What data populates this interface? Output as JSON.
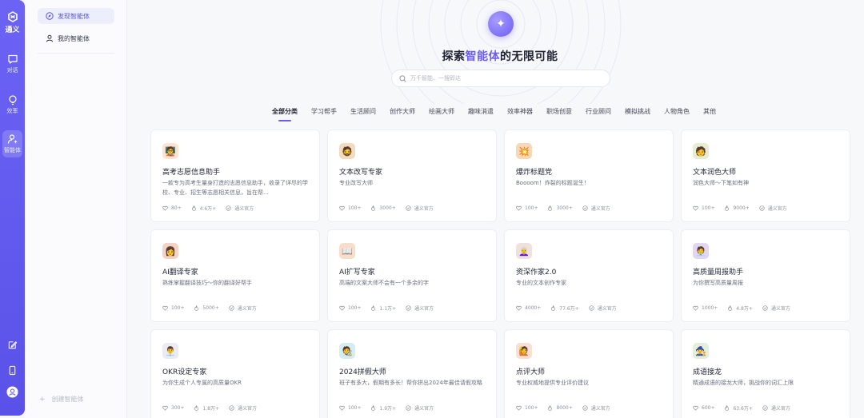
{
  "app": {
    "logo_label": "通义",
    "rail": [
      {
        "label": "对话",
        "icon": "chat-icon"
      },
      {
        "label": "效率",
        "icon": "lightbulb-icon"
      },
      {
        "label": "智能体",
        "icon": "agent-icon"
      }
    ]
  },
  "sidebar": {
    "items": [
      {
        "label": "发现智能体",
        "icon": "compass-icon"
      },
      {
        "label": "我的智能体",
        "icon": "user-icon"
      }
    ],
    "create_label": "创建智能体"
  },
  "hero": {
    "title_prefix": "探索",
    "title_highlight": "智能体",
    "title_suffix": "的无限可能",
    "search_placeholder": "万千智能、一搜即达"
  },
  "tabs": [
    "全部分类",
    "学习帮手",
    "生活顾问",
    "创作大师",
    "绘画大师",
    "趣味消遣",
    "效率神器",
    "职场创意",
    "行业顾问",
    "模拟挑战",
    "人物角色",
    "其他"
  ],
  "cards": [
    {
      "name": "高考志愿信息助手",
      "desc": "一款专为高考生量身打造的志愿信息助手，收录了详尽的学校、专业、招生等志愿相关信息，旨在帮...",
      "likes": "80+",
      "uses": "4.6万+",
      "author": "通义官方",
      "emoji": "🧑‍🏫",
      "bg": "#fde3d2"
    },
    {
      "name": "文本改写专家",
      "desc": "专业改写大师",
      "likes": "100+",
      "uses": "3000+",
      "author": "通义官方",
      "emoji": "🧔",
      "bg": "#f2dcc0"
    },
    {
      "name": "爆炸标题党",
      "desc": "Boooom！炸裂的标题诞生！",
      "likes": "100+",
      "uses": "3000+",
      "author": "通义官方",
      "emoji": "💥",
      "bg": "#f7d9b5"
    },
    {
      "name": "文本润色大师",
      "desc": "润色大师～下笔如有神",
      "likes": "100+",
      "uses": "9000+",
      "author": "通义官方",
      "emoji": "🧑",
      "bg": "#e6edd0"
    },
    {
      "name": "AI翻译专家",
      "desc": "熟练掌握翻译技巧～你的翻译好帮手",
      "likes": "100+",
      "uses": "5000+",
      "author": "通义官方",
      "emoji": "👩",
      "bg": "#f4d3c6"
    },
    {
      "name": "AI扩写专家",
      "desc": "高端的文案大师不会有一个多余的字",
      "likes": "100+",
      "uses": "1.1万+",
      "author": "通义官方",
      "emoji": "📖",
      "bg": "#f6dec8"
    },
    {
      "name": "资深作家2.0",
      "desc": "专业的文本创作专家",
      "likes": "4000+",
      "uses": "77.6万+",
      "author": "通义官方",
      "emoji": "👩‍🦳",
      "bg": "#f1e1dc"
    },
    {
      "name": "高质量周报助手",
      "desc": "为你撰写高质量周报",
      "likes": "1000+",
      "uses": "4.8万+",
      "author": "通义官方",
      "emoji": "🧑‍💼",
      "bg": "#e2d6f0"
    },
    {
      "name": "OKR设定专家",
      "desc": "为你生成个人专属的高质量OKR",
      "likes": "300+",
      "uses": "1.8万+",
      "author": "通义官方",
      "emoji": "👨‍💼",
      "bg": "#eceaf2"
    },
    {
      "name": "2024拼假大师",
      "desc": "班子有多大，假期有多长！帮你拼出2024年最佳请假攻略",
      "likes": "100+",
      "uses": "1.9万+",
      "author": "通义官方",
      "emoji": "🧑‍🎨",
      "bg": "#d4ecf2"
    },
    {
      "name": "点评大师",
      "desc": "专业权威地提供专业评价建议",
      "likes": "100+",
      "uses": "8000+",
      "author": "通义官方",
      "emoji": "🙋",
      "bg": "#f9e0d6"
    },
    {
      "name": "成语接龙",
      "desc": "精通成语的接龙大师，挑战你的词汇上限",
      "likes": "600+",
      "uses": "63.6万+",
      "author": "通义官方",
      "emoji": "🧙",
      "bg": "#e4efd9"
    }
  ]
}
